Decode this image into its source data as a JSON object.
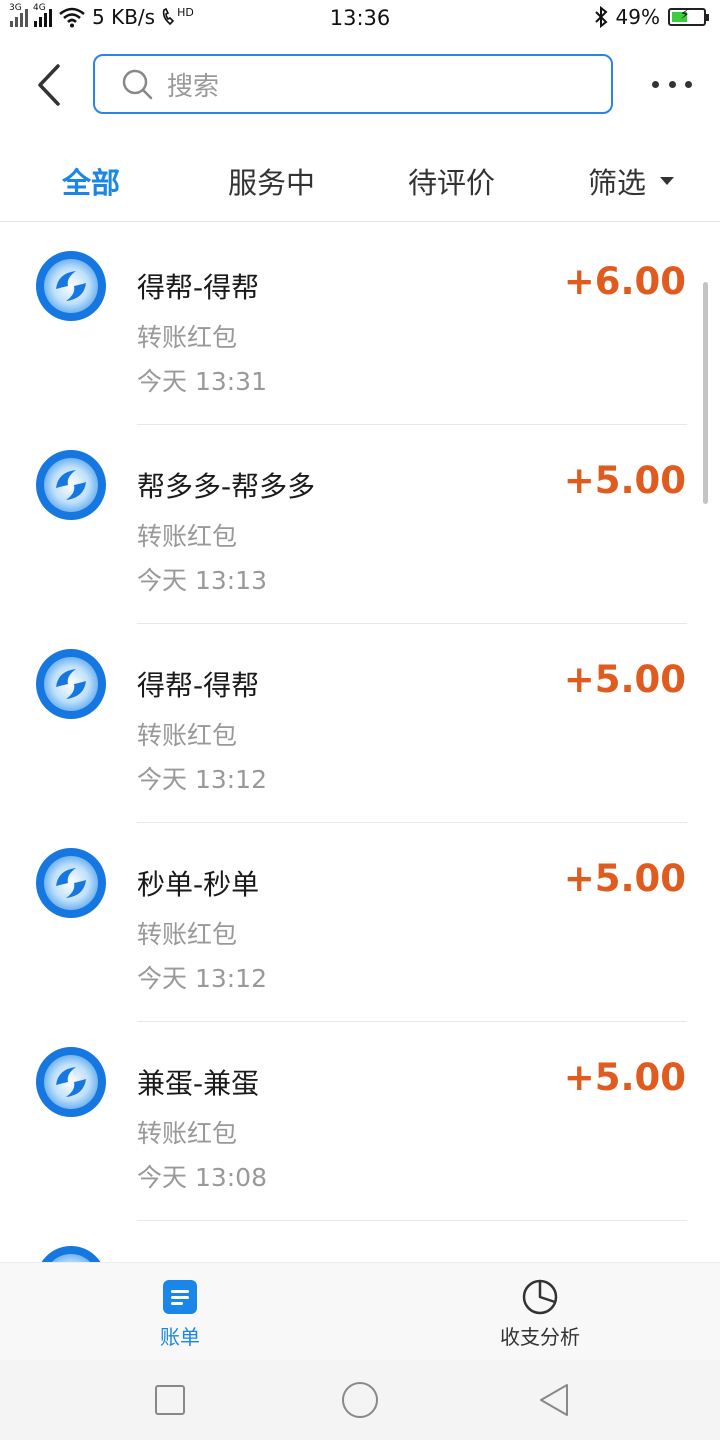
{
  "status_bar": {
    "network_3g": "3G",
    "network_4g": "4G",
    "speed": "5 KB/s",
    "hd": "HD",
    "time": "13:36",
    "battery": "49%",
    "battery_fraction": 0.49
  },
  "header": {
    "search_placeholder": "搜索"
  },
  "tabs": [
    {
      "label": "全部",
      "active": true
    },
    {
      "label": "服务中",
      "active": false
    },
    {
      "label": "待评价",
      "active": false
    },
    {
      "label": "筛选",
      "active": false
    }
  ],
  "records": [
    {
      "name": "得帮-得帮",
      "type": "转账红包",
      "time": "今天  13:31",
      "amount": "+6.00"
    },
    {
      "name": "帮多多-帮多多",
      "type": "转账红包",
      "time": "今天  13:13",
      "amount": "+5.00"
    },
    {
      "name": "得帮-得帮",
      "type": "转账红包",
      "time": "今天  13:12",
      "amount": "+5.00"
    },
    {
      "name": "秒单-秒单",
      "type": "转账红包",
      "time": "今天  13:12",
      "amount": "+5.00"
    },
    {
      "name": "兼蛋-兼蛋",
      "type": "转账红包",
      "time": "今天  13:08",
      "amount": "+5.00"
    },
    {
      "name": "",
      "type": "",
      "time": "",
      "amount": ""
    }
  ],
  "bottom_nav": {
    "bill_label": "账单",
    "analysis_label": "收支分析"
  },
  "colors": {
    "accent": "#1a86e8",
    "amount": "#e05b1e",
    "muted_text": "#999999"
  }
}
